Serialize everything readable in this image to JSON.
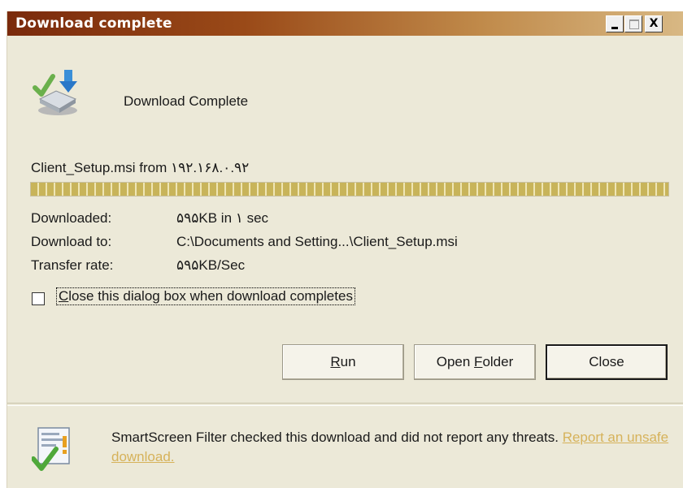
{
  "window": {
    "title": "Download complete",
    "titlebar_colors": {
      "left": "#7a2a0c",
      "right": "#d8b884"
    }
  },
  "titlebar_buttons": {
    "minimize_icon": "minimize-icon",
    "maximize_icon": "maximize-icon",
    "close_icon": "close-icon",
    "close_glyph": "X"
  },
  "header": {
    "icon": "download-complete-icon",
    "text": "Download Complete"
  },
  "download": {
    "source_line": "Client_Setup.msi from ۱۹۲.۱۶۸.۰.۹۲",
    "progress": 1.0,
    "downloaded_label": "Downloaded:",
    "downloaded_value": "۵۹۵KB in ۱ sec",
    "download_to_label": "Download to:",
    "download_to_value": "C:\\Documents and Setting...\\Client_Setup.msi",
    "transfer_rate_label": "Transfer rate:",
    "transfer_rate_value": "۵۹۵KB/Sec"
  },
  "option": {
    "checked": false,
    "label_mnemonic": "C",
    "label_rest": "lose this dialog box when download completes"
  },
  "buttons": {
    "run_mnemonic": "R",
    "run_rest": "un",
    "open_folder_prefix": "Open ",
    "open_folder_mnemonic": "F",
    "open_folder_rest": "older",
    "close": "Close"
  },
  "smartscreen": {
    "icon": "shield-check-icon",
    "message": "SmartScreen Filter checked this download and did not report any threats. ",
    "link": "Report an unsafe download.",
    "link_color": "#d6b25a"
  }
}
